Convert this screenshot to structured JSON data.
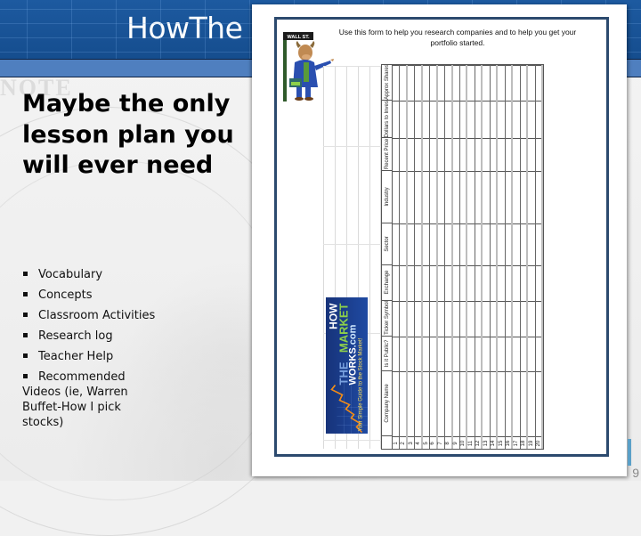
{
  "slide": {
    "title": "HowThe",
    "heading": "Maybe the only lesson plan you will ever need",
    "bullets": [
      "Vocabulary",
      "Concepts",
      "Classroom Activities",
      "Research log",
      "Teacher Help",
      "Recommended Videos (ie, Warren Buffet-How I pick stocks)"
    ],
    "page_number": "9"
  },
  "form_image": {
    "caption": "Use this form to help you research companies and to help you get your portfolio started.",
    "mascot_sign": "WALL ST.",
    "logo": {
      "line1": "HOW",
      "line2a": "THE",
      "line2b": "MARKET",
      "line3": "WORKS",
      "line3_suffix": ".com",
      "tagline": "Your Simple Guide to the Stock Market!"
    },
    "columns": [
      "Company Name",
      "Is it Public?",
      "Ticker Symbol",
      "Exchange",
      "Sector",
      "Industry",
      "Recent Price",
      "Dollars to Invest",
      "Approx Shares"
    ],
    "rows": [
      "1",
      "2",
      "3",
      "4",
      "5",
      "6",
      "7",
      "8",
      "9",
      "10",
      "11",
      "12",
      "13",
      "14",
      "15",
      "16",
      "17",
      "18",
      "19",
      "20"
    ]
  },
  "colors": {
    "title_band": "#1d5aa0",
    "sub_band": "#4f7fbf",
    "frame": "#2c4a6e",
    "logo_green": "#8ed14a"
  }
}
